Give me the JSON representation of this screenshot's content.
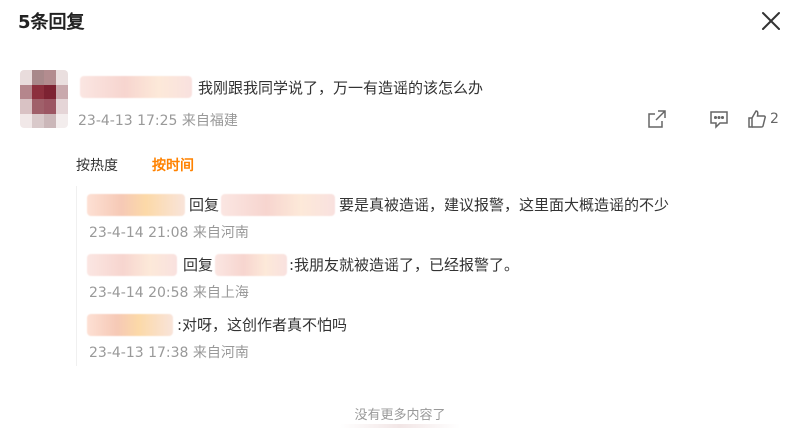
{
  "header": {
    "title": "5条回复",
    "close_icon": "close-icon"
  },
  "main_comment": {
    "text": "我刚跟我同学说了，万一有造谣的该怎么办",
    "time": "23-4-13 17:25",
    "source": "来自福建",
    "like_count": "2",
    "icons": [
      "share-icon",
      "comment-icon",
      "like-icon"
    ]
  },
  "sort": {
    "hot": "按热度",
    "time": "按时间",
    "active_color": "#ff8200"
  },
  "replies": [
    {
      "reply_prefix": "回复",
      "text": "要是真被造谣，建议报警，这里面大概造谣的不少",
      "time": "23-4-14 21:08",
      "source": "来自河南"
    },
    {
      "reply_prefix": "回复",
      "text": ":我朋友就被造谣了，已经报警了。",
      "time": "23-4-14 20:58",
      "source": "来自上海"
    },
    {
      "text": ":对呀，这创作者真不怕吗",
      "time": "23-4-13 17:38",
      "source": "来自河南"
    }
  ],
  "footer": {
    "no_more": "没有更多内容了"
  },
  "colors": {
    "accent": "#ff8200",
    "meta": "#999999",
    "text": "#333333"
  }
}
